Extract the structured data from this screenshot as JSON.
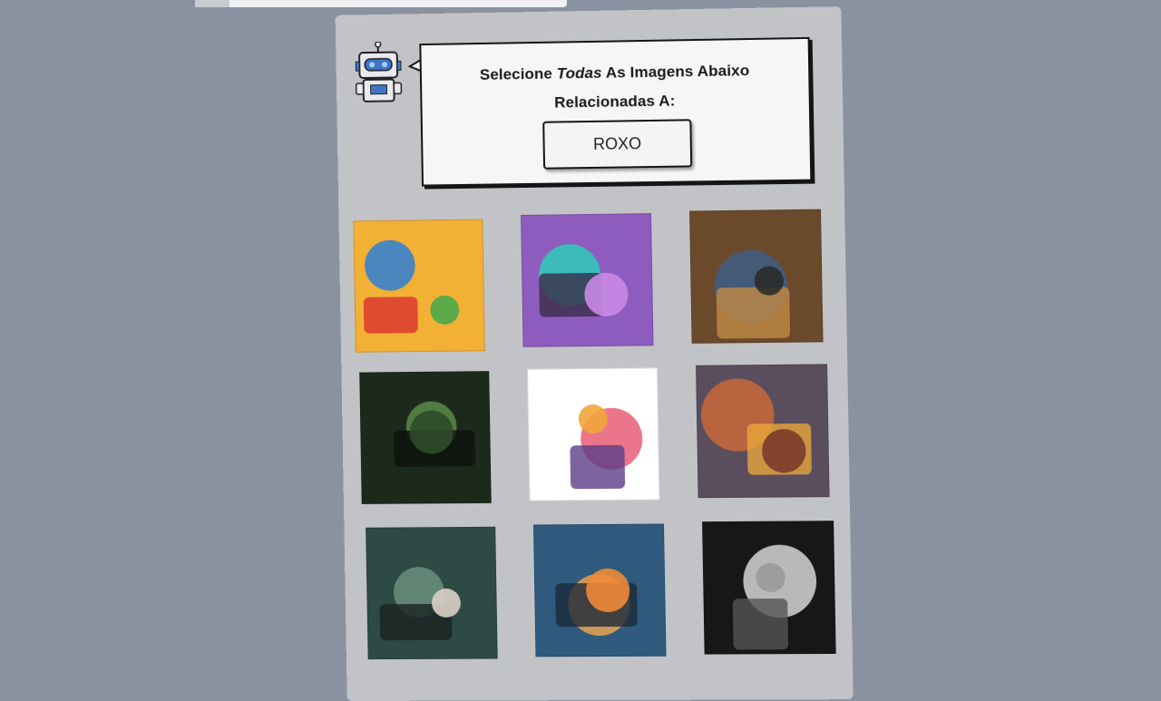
{
  "captcha": {
    "prompt_before": "Selecione ",
    "prompt_emphasis": "Todas",
    "prompt_after": " As Imagens Abaixo Relacionadas A:",
    "target_word": "ROXO"
  },
  "tiles": [
    {
      "name": "puzzle-pieces-image",
      "palette": [
        "#f2b035",
        "#2e7fd6",
        "#d8322e",
        "#4aa84a"
      ]
    },
    {
      "name": "witches-cauldron-image",
      "palette": [
        "#8e5bbf",
        "#2dcdb8",
        "#3b2d48",
        "#c98ae6"
      ]
    },
    {
      "name": "raccoons-treasure-image",
      "palette": [
        "#6b4a2c",
        "#3d5d85",
        "#c08a43",
        "#2b2b2b"
      ]
    },
    {
      "name": "dark-forest-figure-image",
      "palette": [
        "#1c2a1c",
        "#5c8a4a",
        "#0d120d",
        "#2f4a2a"
      ]
    },
    {
      "name": "food-characters-image",
      "palette": [
        "#ffffff",
        "#e85d75",
        "#5c3d86",
        "#f2a53a"
      ]
    },
    {
      "name": "fox-chefs-image",
      "palette": [
        "#5a4e5e",
        "#c9683a",
        "#e8a63b",
        "#7b3a2a"
      ]
    },
    {
      "name": "green-door-teddy-image",
      "palette": [
        "#2d4a45",
        "#6b8f7d",
        "#1a2220",
        "#d9d2c5"
      ]
    },
    {
      "name": "giraffe-bowtie-image",
      "palette": [
        "#2f5a7e",
        "#e8a34e",
        "#1b2a3a",
        "#f08a3a"
      ]
    },
    {
      "name": "skull-cat-image",
      "palette": [
        "#171717",
        "#d6d6d6",
        "#555555",
        "#9a9a9a"
      ]
    }
  ]
}
